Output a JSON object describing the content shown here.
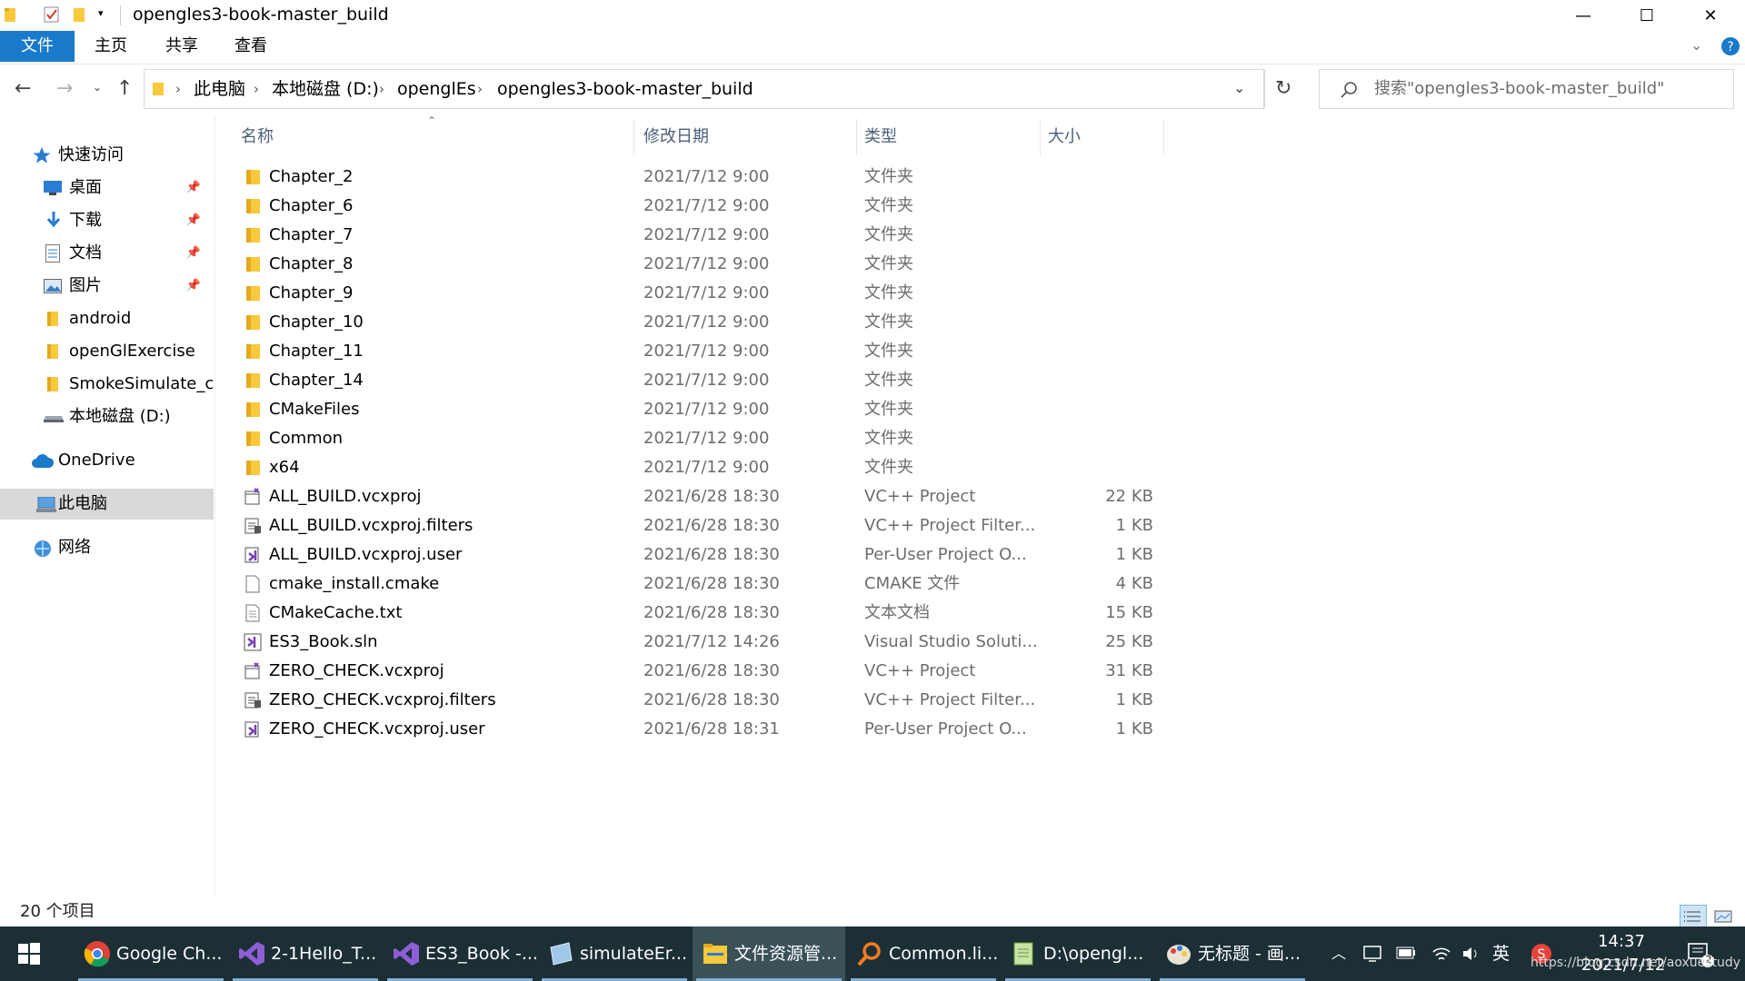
{
  "window": {
    "title": "opengles3-book-master_build",
    "controls": [
      "—",
      "☐",
      "✕"
    ]
  },
  "ribbon": {
    "tabs": [
      "文件",
      "主页",
      "共享",
      "查看"
    ]
  },
  "address": {
    "crumbs": [
      "此电脑",
      "本地磁盘 (D:)",
      "openglEs",
      "opengles3-book-master_build"
    ],
    "search_placeholder": "搜索\"opengles3-book-master_build\""
  },
  "sidebar": {
    "items": [
      {
        "label": "快速访问",
        "icon": "star-icon"
      },
      {
        "label": "桌面",
        "icon": "desktop-icon",
        "pinned": true
      },
      {
        "label": "下载",
        "icon": "download-icon",
        "pinned": true
      },
      {
        "label": "文档",
        "icon": "document-icon",
        "pinned": true
      },
      {
        "label": "图片",
        "icon": "picture-icon",
        "pinned": true
      },
      {
        "label": "android",
        "icon": "folder-icon"
      },
      {
        "label": "openGlExercise",
        "icon": "folder-icon"
      },
      {
        "label": "SmokeSimulate_cc",
        "icon": "folder-icon"
      },
      {
        "label": "本地磁盘 (D:)",
        "icon": "drive-icon"
      },
      {
        "label": "OneDrive",
        "icon": "cloud-icon"
      },
      {
        "label": "此电脑",
        "icon": "pc-icon",
        "selected": true
      },
      {
        "label": "网络",
        "icon": "network-icon"
      }
    ]
  },
  "columns": {
    "name": "名称",
    "date": "修改日期",
    "type": "类型",
    "size": "大小"
  },
  "files": [
    {
      "name": "Chapter_2",
      "date": "2021/7/12 9:00",
      "type": "文件夹",
      "size": "",
      "icon": "folder"
    },
    {
      "name": "Chapter_6",
      "date": "2021/7/12 9:00",
      "type": "文件夹",
      "size": "",
      "icon": "folder"
    },
    {
      "name": "Chapter_7",
      "date": "2021/7/12 9:00",
      "type": "文件夹",
      "size": "",
      "icon": "folder"
    },
    {
      "name": "Chapter_8",
      "date": "2021/7/12 9:00",
      "type": "文件夹",
      "size": "",
      "icon": "folder"
    },
    {
      "name": "Chapter_9",
      "date": "2021/7/12 9:00",
      "type": "文件夹",
      "size": "",
      "icon": "folder"
    },
    {
      "name": "Chapter_10",
      "date": "2021/7/12 9:00",
      "type": "文件夹",
      "size": "",
      "icon": "folder"
    },
    {
      "name": "Chapter_11",
      "date": "2021/7/12 9:00",
      "type": "文件夹",
      "size": "",
      "icon": "folder"
    },
    {
      "name": "Chapter_14",
      "date": "2021/7/12 9:00",
      "type": "文件夹",
      "size": "",
      "icon": "folder"
    },
    {
      "name": "CMakeFiles",
      "date": "2021/7/12 9:00",
      "type": "文件夹",
      "size": "",
      "icon": "folder"
    },
    {
      "name": "Common",
      "date": "2021/7/12 9:00",
      "type": "文件夹",
      "size": "",
      "icon": "folder"
    },
    {
      "name": "x64",
      "date": "2021/7/12 9:00",
      "type": "文件夹",
      "size": "",
      "icon": "folder"
    },
    {
      "name": "ALL_BUILD.vcxproj",
      "date": "2021/6/28 18:30",
      "type": "VC++ Project",
      "size": "22 KB",
      "icon": "vcxproj"
    },
    {
      "name": "ALL_BUILD.vcxproj.filters",
      "date": "2021/6/28 18:30",
      "type": "VC++ Project Filter...",
      "size": "1 KB",
      "icon": "filters"
    },
    {
      "name": "ALL_BUILD.vcxproj.user",
      "date": "2021/6/28 18:30",
      "type": "Per-User Project O...",
      "size": "1 KB",
      "icon": "user"
    },
    {
      "name": "cmake_install.cmake",
      "date": "2021/6/28 18:30",
      "type": "CMAKE 文件",
      "size": "4 KB",
      "icon": "blank"
    },
    {
      "name": "CMakeCache.txt",
      "date": "2021/6/28 18:30",
      "type": "文本文档",
      "size": "15 KB",
      "icon": "text"
    },
    {
      "name": "ES3_Book.sln",
      "date": "2021/7/12 14:26",
      "type": "Visual Studio Soluti...",
      "size": "25 KB",
      "icon": "sln"
    },
    {
      "name": "ZERO_CHECK.vcxproj",
      "date": "2021/6/28 18:30",
      "type": "VC++ Project",
      "size": "31 KB",
      "icon": "vcxproj"
    },
    {
      "name": "ZERO_CHECK.vcxproj.filters",
      "date": "2021/6/28 18:30",
      "type": "VC++ Project Filter...",
      "size": "1 KB",
      "icon": "filters"
    },
    {
      "name": "ZERO_CHECK.vcxproj.user",
      "date": "2021/6/28 18:31",
      "type": "Per-User Project O...",
      "size": "1 KB",
      "icon": "user"
    }
  ],
  "status": {
    "count": "20 个项目"
  },
  "taskbar": {
    "items": [
      {
        "label": "Google Ch...",
        "icon": "chrome-icon"
      },
      {
        "label": "2-1Hello_T...",
        "icon": "visual-studio-icon"
      },
      {
        "label": "ES3_Book -...",
        "icon": "visual-studio-icon"
      },
      {
        "label": "simulateEr...",
        "icon": "app-icon"
      },
      {
        "label": "文件资源管...",
        "icon": "file-explorer-icon",
        "active": true
      },
      {
        "label": "Common.li...",
        "icon": "search-tool-icon"
      },
      {
        "label": "D:\\opengl...",
        "icon": "notepad-icon"
      },
      {
        "label": "无标题 - 画...",
        "icon": "paint-icon"
      }
    ],
    "tray": {
      "ime": "英",
      "time": "14:37",
      "date": "2021/7/12",
      "notifications": "2"
    },
    "watermark": "https://blog.csdn.net/aoxuestudy"
  },
  "colors": {
    "accent": "#1979ca",
    "taskbar": "#1c2f35",
    "folder": "#f8c93a",
    "selected_nav": "#d9d9d9"
  }
}
